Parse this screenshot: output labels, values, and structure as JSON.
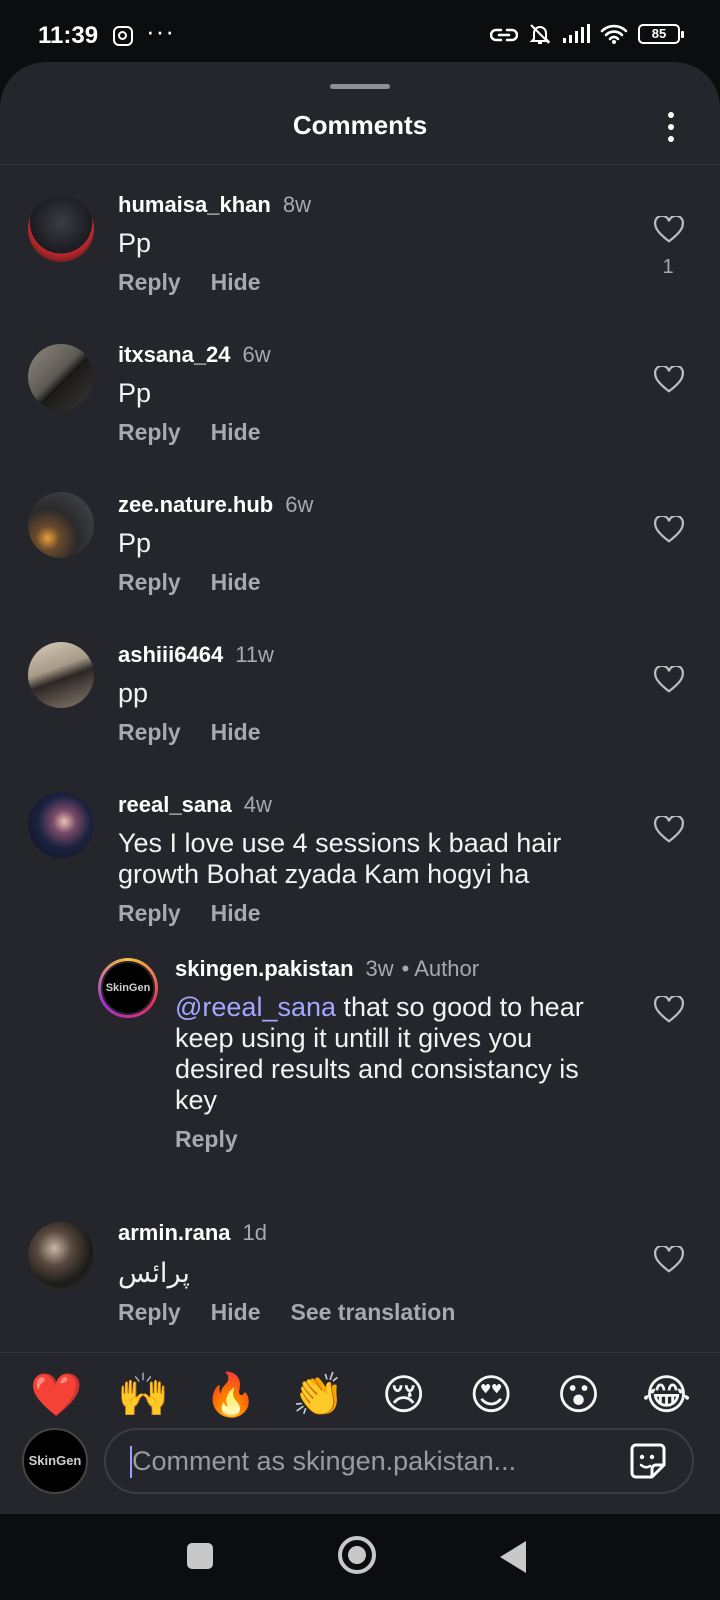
{
  "status_bar": {
    "time": "11:39",
    "dots": "···",
    "battery": "85",
    "icons": [
      "instagram-icon",
      "link-icon",
      "bell-off-icon",
      "signal-icon",
      "wifi-icon",
      "battery-icon"
    ]
  },
  "sheet": {
    "title": "Comments"
  },
  "comments": [
    {
      "username": "humaisa_khan",
      "time": "8w",
      "text": "Pp",
      "actions": [
        "Reply",
        "Hide"
      ],
      "likes": "1"
    },
    {
      "username": "itxsana_24",
      "time": "6w",
      "text": "Pp",
      "actions": [
        "Reply",
        "Hide"
      ]
    },
    {
      "username": "zee.nature.hub",
      "time": "6w",
      "text": "Pp",
      "actions": [
        "Reply",
        "Hide"
      ]
    },
    {
      "username": "ashiii6464",
      "time": "11w",
      "text": "pp",
      "actions": [
        "Reply",
        "Hide"
      ]
    },
    {
      "username": "reeal_sana",
      "time": "4w",
      "text": "Yes I love use 4 sessions k baad hair growth Bohat zyada Kam hogyi ha",
      "actions": [
        "Reply",
        "Hide"
      ]
    },
    {
      "username": "armin.rana",
      "time": "1d",
      "text": "پرائس",
      "actions": [
        "Reply",
        "Hide",
        "See translation"
      ]
    }
  ],
  "reply": {
    "username": "skingen.pakistan",
    "time": "3w",
    "author_tag": "• Author",
    "mention": "@reeal_sana",
    "text": " that so good to hear keep using it untill it gives you desired results and consistancy is key",
    "action": "Reply",
    "avatar_label": "SkinGen"
  },
  "emoji_bar": [
    "❤️",
    "🙌",
    "🔥",
    "👏",
    "😢",
    "😍",
    "😮",
    "😂"
  ],
  "composer": {
    "avatar_label": "SkinGen",
    "placeholder": "Comment as skingen.pakistan..."
  },
  "colors": {
    "sheet_bg": "#25262b",
    "mention": "#a3a8ff",
    "muted_text": "#a8a9ad"
  }
}
